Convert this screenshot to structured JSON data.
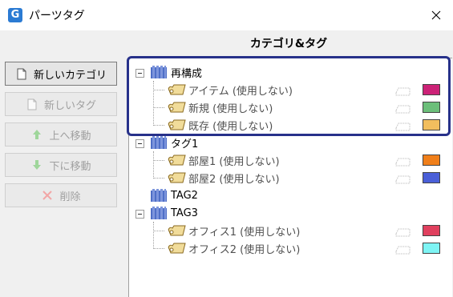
{
  "window": {
    "title": "パーツタグ"
  },
  "header": {
    "label": "カテゴリ&タグ"
  },
  "sidebar": {
    "new_category": "新しいカテゴリ",
    "new_tag": "新しいタグ",
    "move_up": "上へ移動",
    "move_down": "下に移動",
    "delete": "削除"
  },
  "tree": {
    "categories": [
      {
        "label": "再構成",
        "expanded": true,
        "tags": [
          {
            "label": "アイテム (使用しない)",
            "color": "#cc2277"
          },
          {
            "label": "新規 (使用しない)",
            "color": "#6cbf7a"
          },
          {
            "label": "既存 (使用しない)",
            "color": "#f2be5e"
          }
        ]
      },
      {
        "label": "タグ1",
        "expanded": true,
        "tags": [
          {
            "label": "部屋1 (使用しない)",
            "color": "#f07f1a"
          },
          {
            "label": "部屋2 (使用しない)",
            "color": "#4a5fd8"
          }
        ]
      },
      {
        "label": "TAG2",
        "expanded": false,
        "tags": []
      },
      {
        "label": "TAG3",
        "expanded": true,
        "tags": [
          {
            "label": "オフィス1 (使用しない)",
            "color": "#e0405e"
          },
          {
            "label": "オフィス2 (使用しない)",
            "color": "#7ef4f4"
          }
        ]
      }
    ]
  },
  "colors": {
    "accent_highlight": "#27318a",
    "folder_blue": "#4f6fc7",
    "tag_yellow": "#f1dc9a"
  },
  "icons": {
    "app": "app-logo-icon",
    "close": "close-icon",
    "new_category": "document-icon",
    "new_tag": "document-icon",
    "move_up": "arrow-up-icon",
    "move_down": "arrow-down-icon",
    "delete": "x-delete-icon",
    "category": "folder-books-icon",
    "tag": "tag-label-icon"
  }
}
